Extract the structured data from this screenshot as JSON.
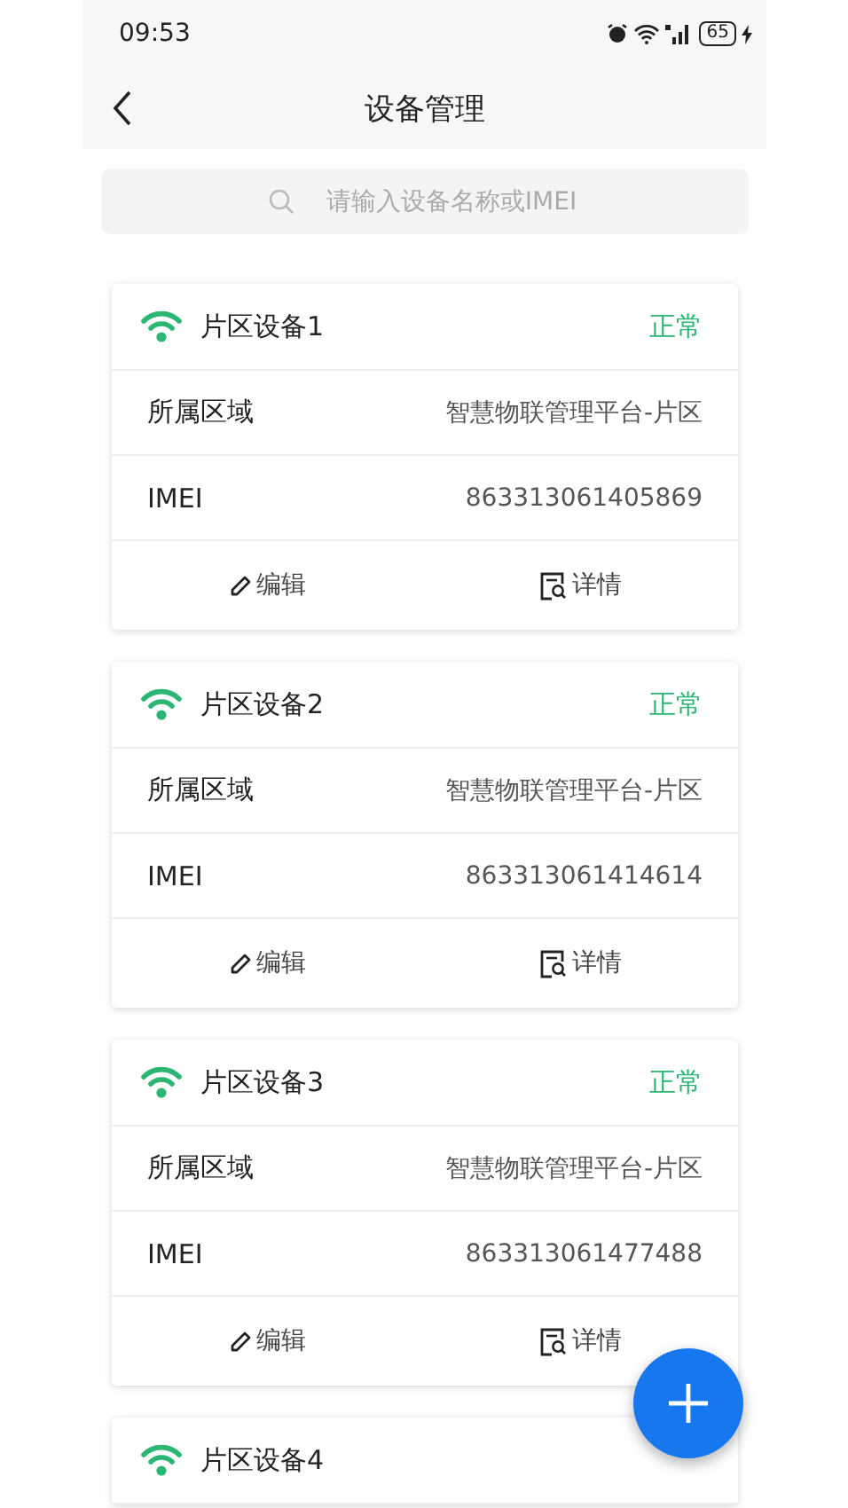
{
  "status_bar": {
    "time": "09:53",
    "battery": "65"
  },
  "header": {
    "title": "设备管理"
  },
  "search": {
    "placeholder": "请输入设备名称或IMEI"
  },
  "devices": [
    {
      "name": "片区设备1",
      "online": true,
      "status": "正常",
      "fields": [
        {
          "label": "所属区域",
          "value": "智慧物联管理平台-片区"
        },
        {
          "label": "IMEI",
          "value": "863313061405869"
        }
      ],
      "actions": [
        {
          "kind": "edit",
          "label": "编辑"
        },
        {
          "kind": "detail",
          "label": "详情"
        }
      ]
    },
    {
      "name": "片区设备2",
      "online": true,
      "status": "正常",
      "fields": [
        {
          "label": "所属区域",
          "value": "智慧物联管理平台-片区"
        },
        {
          "label": "IMEI",
          "value": "863313061414614"
        }
      ],
      "actions": [
        {
          "kind": "edit",
          "label": "编辑"
        },
        {
          "kind": "detail",
          "label": "详情"
        }
      ]
    },
    {
      "name": "片区设备3",
      "online": true,
      "status": "正常",
      "fields": [
        {
          "label": "所属区域",
          "value": "智慧物联管理平台-片区"
        },
        {
          "label": "IMEI",
          "value": "863313061477488"
        }
      ],
      "actions": [
        {
          "kind": "edit",
          "label": "编辑"
        },
        {
          "kind": "detail",
          "label": "详情"
        }
      ]
    },
    {
      "name": "片区设备4",
      "online": true
    }
  ]
}
